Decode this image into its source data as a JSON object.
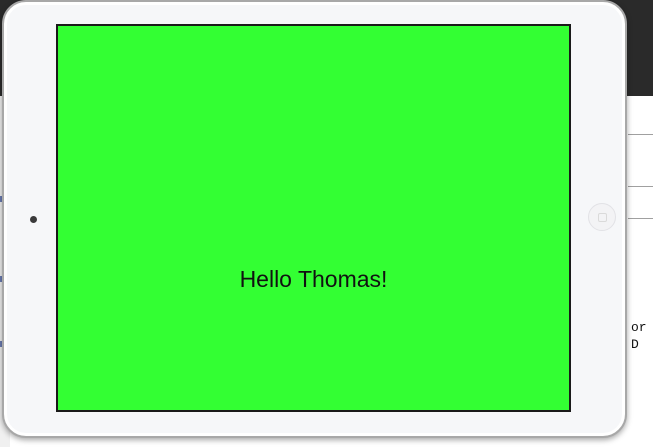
{
  "background": {
    "code_lines": [
      "or",
      "D"
    ]
  },
  "simulator": {
    "device": "iPad",
    "screen": {
      "background_color": "#33ff33",
      "greeting": "Hello Thomas!"
    },
    "icons": {
      "camera": "front-camera-icon",
      "home": "home-button-icon"
    }
  }
}
